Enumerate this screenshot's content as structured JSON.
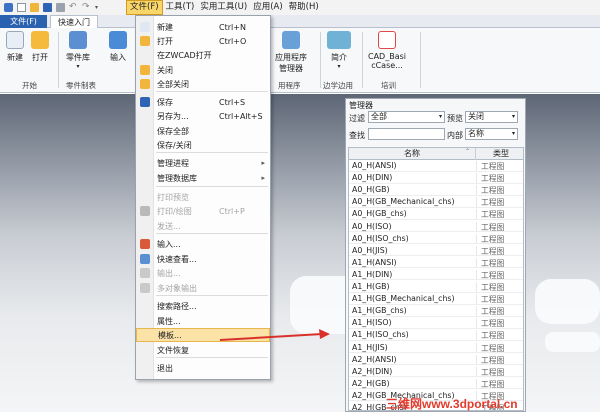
{
  "menubar": {
    "items": [
      "文件(F)",
      "工具(T)",
      "实用工具(U)",
      "应用(A)",
      "帮助(H)"
    ]
  },
  "tabs": {
    "file": "文件(F)",
    "quick": "快速入门"
  },
  "ribbon": {
    "buttons": [
      {
        "label": "新建",
        "icon": "new-file-icon",
        "color": "#e8eef6"
      },
      {
        "label": "打开",
        "icon": "open-folder-icon",
        "color": "#f5b93b"
      },
      {
        "label": "零件库",
        "icon": "parts-library-icon",
        "color": "#5a8fd1"
      },
      {
        "label": "输入",
        "icon": "import-icon",
        "color": "#4a8ad6"
      },
      {
        "label": "管理器",
        "icon": "manager-icon",
        "color": "#6aa0d8"
      },
      {
        "label": "简介",
        "icon": "stt-icon",
        "color": "#6fb2d6"
      },
      {
        "label": "CAD_Basi\ncCase...",
        "icon": "cad-case-icon",
        "color": "#e24848"
      }
    ],
    "extra_label": "应用程序",
    "groups": [
      "开始",
      "零件制表",
      "边学边用",
      "培训"
    ],
    "group_suffix": "用程序"
  },
  "file_menu": {
    "items": [
      {
        "label": "新建",
        "shortcut": "Ctrl+N",
        "icon": "new-icon",
        "color": "#dfe7f1"
      },
      {
        "label": "打开",
        "shortcut": "Ctrl+O",
        "icon": "open-icon",
        "color": "#f2b53c"
      },
      {
        "label": "在ZWCAD打开",
        "shortcut": "",
        "icon": "",
        "color": ""
      },
      {
        "label": "关闭",
        "shortcut": "",
        "icon": "close-icon",
        "color": "#f2b53c"
      },
      {
        "label": "全部关闭",
        "shortcut": "",
        "icon": "close-all-icon",
        "color": "#f2b53c"
      },
      {
        "label": "保存",
        "shortcut": "Ctrl+S",
        "icon": "save-icon",
        "color": "#2f63b4"
      },
      {
        "label": "另存为...",
        "shortcut": "Ctrl+Alt+S",
        "icon": "",
        "color": ""
      },
      {
        "label": "保存全部",
        "shortcut": "",
        "icon": "",
        "color": ""
      },
      {
        "label": "保存/关闭",
        "shortcut": "",
        "icon": "",
        "color": ""
      },
      {
        "label": "管理进程",
        "shortcut": "",
        "icon": "",
        "color": ""
      },
      {
        "label": "管理数据库",
        "shortcut": "",
        "icon": "",
        "color": ""
      },
      {
        "label": "打印预览",
        "shortcut": "",
        "icon": "",
        "color": ""
      },
      {
        "label": "打印/绘图",
        "shortcut": "Ctrl+P",
        "icon": "print-icon",
        "color": "#b9b9b9"
      },
      {
        "label": "发送...",
        "shortcut": "",
        "icon": "",
        "color": ""
      },
      {
        "label": "输入...",
        "shortcut": "",
        "icon": "import-icon",
        "color": "#d95a3a"
      },
      {
        "label": "快速查看...",
        "shortcut": "",
        "icon": "quick-view-icon",
        "color": "#5a8fd1"
      },
      {
        "label": "输出...",
        "shortcut": "",
        "icon": "export-icon",
        "color": "#c9c9c9"
      },
      {
        "label": "多对象输出",
        "shortcut": "",
        "icon": "multi-export-icon",
        "color": "#c9c9c9"
      },
      {
        "label": "搜索路径...",
        "shortcut": "",
        "icon": "",
        "color": ""
      },
      {
        "label": "属性...",
        "shortcut": "",
        "icon": "",
        "color": ""
      },
      {
        "label": "模板...",
        "shortcut": "",
        "icon": "",
        "color": ""
      },
      {
        "label": "文件恢复",
        "shortcut": "",
        "icon": "",
        "color": ""
      },
      {
        "label": "退出",
        "shortcut": "",
        "icon": "",
        "color": ""
      }
    ]
  },
  "manager": {
    "title": "管理器",
    "filter_label": "过滤",
    "filter_value": "全部",
    "preview_label": "预览",
    "preview_value": "关闭",
    "search_label": "查找",
    "search_value": "",
    "inner_label": "内部",
    "inner_value": "名称",
    "col_name": "名称",
    "col_type": "类型",
    "rows": [
      {
        "name": "A0_H(ANSI)",
        "type": "工程图"
      },
      {
        "name": "A0_H(DIN)",
        "type": "工程图"
      },
      {
        "name": "A0_H(GB)",
        "type": "工程图"
      },
      {
        "name": "A0_H(GB_Mechanical_chs)",
        "type": "工程图"
      },
      {
        "name": "A0_H(GB_chs)",
        "type": "工程图"
      },
      {
        "name": "A0_H(ISO)",
        "type": "工程图"
      },
      {
        "name": "A0_H(ISO_chs)",
        "type": "工程图"
      },
      {
        "name": "A0_H(JIS)",
        "type": "工程图"
      },
      {
        "name": "A1_H(ANSI)",
        "type": "工程图"
      },
      {
        "name": "A1_H(DIN)",
        "type": "工程图"
      },
      {
        "name": "A1_H(GB)",
        "type": "工程图"
      },
      {
        "name": "A1_H(GB_Mechanical_chs)",
        "type": "工程图"
      },
      {
        "name": "A1_H(GB_chs)",
        "type": "工程图"
      },
      {
        "name": "A1_H(ISO)",
        "type": "工程图"
      },
      {
        "name": "A1_H(ISO_chs)",
        "type": "工程图"
      },
      {
        "name": "A1_H(JIS)",
        "type": "工程图"
      },
      {
        "name": "A2_H(ANSI)",
        "type": "工程图"
      },
      {
        "name": "A2_H(DIN)",
        "type": "工程图"
      },
      {
        "name": "A2_H(GB)",
        "type": "工程图"
      },
      {
        "name": "A2_H(GB_Mechanical_chs)",
        "type": "工程图"
      },
      {
        "name": "A2_H(GB_chs)",
        "type": "工程图"
      }
    ]
  },
  "watermark": "三维网www.3dportal.cn",
  "colors": {
    "accent": "#2b62b0",
    "highlight": "#fbe3a8",
    "arrow": "#d9312a"
  }
}
